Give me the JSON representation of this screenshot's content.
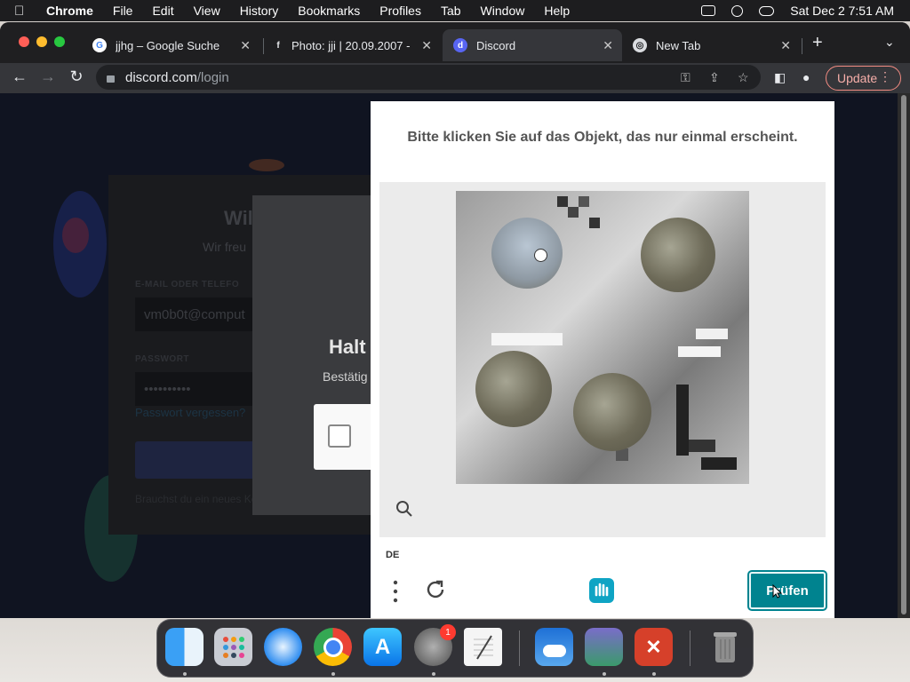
{
  "menubar": {
    "app_name": "Chrome",
    "items": [
      "File",
      "Edit",
      "View",
      "History",
      "Bookmarks",
      "Profiles",
      "Tab",
      "Window",
      "Help"
    ],
    "clock": "Sat Dec 2  7:51 AM"
  },
  "tabs": [
    {
      "title": "jjhg – Google Suche",
      "favicon": "google-icon",
      "active": false
    },
    {
      "title": "Photo: jji | 20.09.2007 -",
      "favicon": "photo-site-icon",
      "active": false
    },
    {
      "title": "Discord",
      "favicon": "discord-icon",
      "active": true
    },
    {
      "title": "New Tab",
      "favicon": "chrome-icon",
      "active": false
    }
  ],
  "address_bar": {
    "domain": "discord.com",
    "path": "/login"
  },
  "toolbar": {
    "update_label": "Update"
  },
  "login_bg": {
    "heading": "Wil",
    "subheading": "Wir freu",
    "email_label": "E-MAIL ODER TELEFO",
    "email_value": "vm0b0t@comput",
    "password_label": "PASSWORT",
    "password_value": "••••••••••",
    "forgot_link": "Passwort vergessen?",
    "register_text": "Brauchst du ein neues Ko"
  },
  "halt_modal": {
    "title": "Halt",
    "subtitle": "Bestätig"
  },
  "captcha": {
    "prompt": "Bitte klicken Sie auf das Objekt, das nur einmal erscheint.",
    "language": "DE",
    "submit_label": "Prüfen",
    "submit_color": "#00838f"
  },
  "dock": {
    "apps": [
      "finder-icon",
      "launchpad-icon",
      "safari-icon",
      "chrome-icon",
      "app-store-icon",
      "system-settings-icon",
      "textedit-icon",
      "weather-icon",
      "photos-icon",
      "remote-desktop-icon",
      "trash-icon"
    ],
    "system_settings_badge": "1"
  }
}
